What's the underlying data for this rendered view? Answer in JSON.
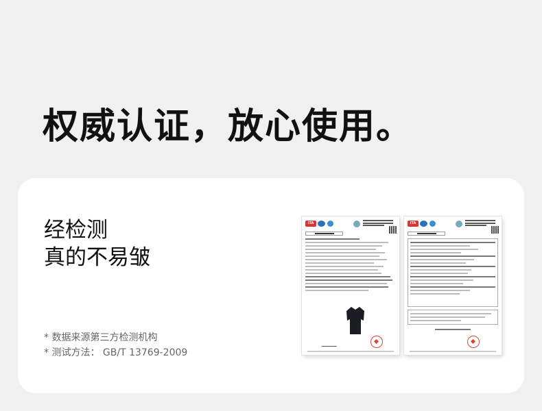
{
  "headline": "权威认证，放心使用。",
  "card": {
    "tagline_line1": "经检测",
    "tagline_line2": "真的不易皱",
    "note_source": "* 数据来源第三方检测机构",
    "note_method": "* 测试方法：  GB/T 13769-2009"
  },
  "reports": [
    {
      "name": "test-report-1",
      "logo_a": "ITA"
    },
    {
      "name": "test-report-2",
      "logo_a": "ITA"
    }
  ],
  "colors": {
    "background": "#f0f0f0",
    "card": "#ffffff",
    "stamp": "#dd4433"
  }
}
